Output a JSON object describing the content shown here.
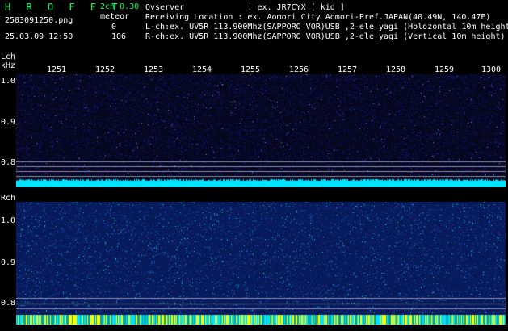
{
  "header": {
    "brand": "H R O F F T",
    "mode": "2ch 0.30",
    "filename": "2503091250.png",
    "meteor_label": "meteor",
    "meteor_l": "0",
    "meteor_r": "106",
    "timestamp": "25.03.09 12:50",
    "observer": "Ovserver             : ex. JR7CYX [ kid ]",
    "location": "Receiving Location : ex. Aomori City Aomori-Pref.JAPAN(40.49N, 140.47E)",
    "lch_desc": "L-ch:ex. UV5R 113.900Mhz(SAPPORO VOR)USB ,2-ele yagi (Holozontal 10m height)",
    "rch_desc": "R-ch:ex. UV5R 113.900Mhz(SAPPORO VOR)USB ,2-ele yagi (Vertical 10m height)"
  },
  "lch": {
    "label": "Lch",
    "unit": "kHz",
    "y_ticks": [
      "1.0",
      "0.9",
      "0.8"
    ],
    "x_ticks": [
      "1251",
      "1252",
      "1253",
      "1254",
      "1255",
      "1256",
      "1257",
      "1258",
      "1259",
      "1300"
    ]
  },
  "rch": {
    "label": "Rch",
    "y_ticks": [
      "1.0",
      "0.9",
      "0.8"
    ]
  },
  "colors": {
    "background": "#000000",
    "cyan": "#00e5ff",
    "green": "#00ff66",
    "yellow": "#ffff00",
    "spectrum_dark": "#05051e"
  }
}
